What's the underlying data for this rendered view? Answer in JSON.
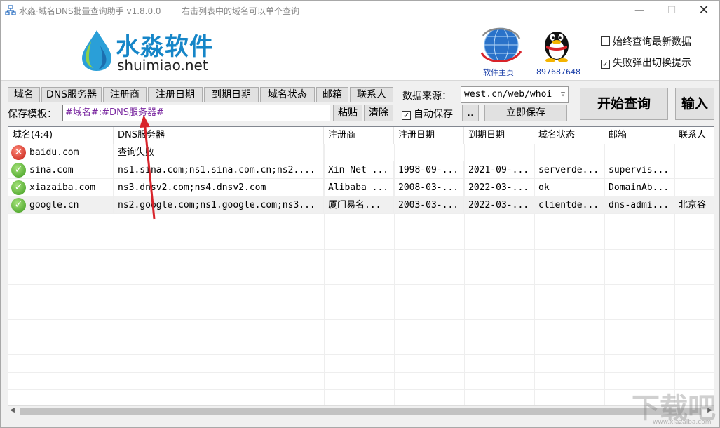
{
  "window": {
    "title": "水淼·域名DNS批量查询助手 v1.8.0.0",
    "hint": "右击列表中的域名可以单个查询",
    "min_glyph": "—",
    "max_glyph": "☐",
    "close_glyph": "✕"
  },
  "header": {
    "logo_title": "水淼软件",
    "logo_sub": "shuimiao.net",
    "homepage_label": "软件主页",
    "qq_number": "897687648",
    "opt_latest": "始终查询最新数据",
    "opt_fail_prompt": "失败弹出切换提示",
    "opt_latest_checked": false,
    "opt_fail_prompt_checked": true
  },
  "fields": [
    "域名",
    "DNS服务器",
    "注册商",
    "注册日期",
    "到期日期",
    "域名状态",
    "邮箱",
    "联系人"
  ],
  "toolbar": {
    "source_label": "数据来源：",
    "source_value": "west.cn/web/whoi",
    "template_label": "保存模板：",
    "template_value": "#域名#:#DNS服务器#",
    "paste_label": "粘贴",
    "clear_label": "清除",
    "auto_save_label": "自动保存",
    "auto_save_checked": true,
    "browse_label": "..",
    "save_now_label": "立即保存",
    "start_label": "开始查询",
    "input_label": "输入"
  },
  "table": {
    "columns": [
      "域名(4:4)",
      "DNS服务器",
      "注册商",
      "注册日期",
      "到期日期",
      "域名状态",
      "邮箱",
      "联系人"
    ],
    "rows": [
      {
        "status": "fail",
        "cells": [
          "baidu.com",
          "查询失败",
          "",
          "",
          "",
          "",
          "",
          ""
        ]
      },
      {
        "status": "ok",
        "cells": [
          "sina.com",
          "ns1.sina.com;ns1.sina.com.cn;ns2....",
          "Xin Net ...",
          "1998-09-...",
          "2021-09-...",
          "serverde...",
          "supervis...",
          ""
        ]
      },
      {
        "status": "ok",
        "cells": [
          "xiazaiba.com",
          "ns3.dnsv2.com;ns4.dnsv2.com",
          "Alibaba ...",
          "2008-03-...",
          "2022-03-...",
          "ok",
          "DomainAb...",
          ""
        ]
      },
      {
        "status": "ok",
        "cells": [
          "google.cn",
          "ns2.google.com;ns1.google.com;ns3...",
          "厦门易名...",
          "2003-03-...",
          "2022-03-...",
          "clientde...",
          "dns-admi...",
          "北京谷"
        ]
      }
    ]
  },
  "watermark": {
    "text": "下载吧",
    "sub": "www.xiazaiba.com"
  },
  "colors": {
    "accent": "#1686c8",
    "link": "#1b3fa8",
    "template_text": "#7a28a0",
    "annotation_arrow": "#d8232a"
  }
}
